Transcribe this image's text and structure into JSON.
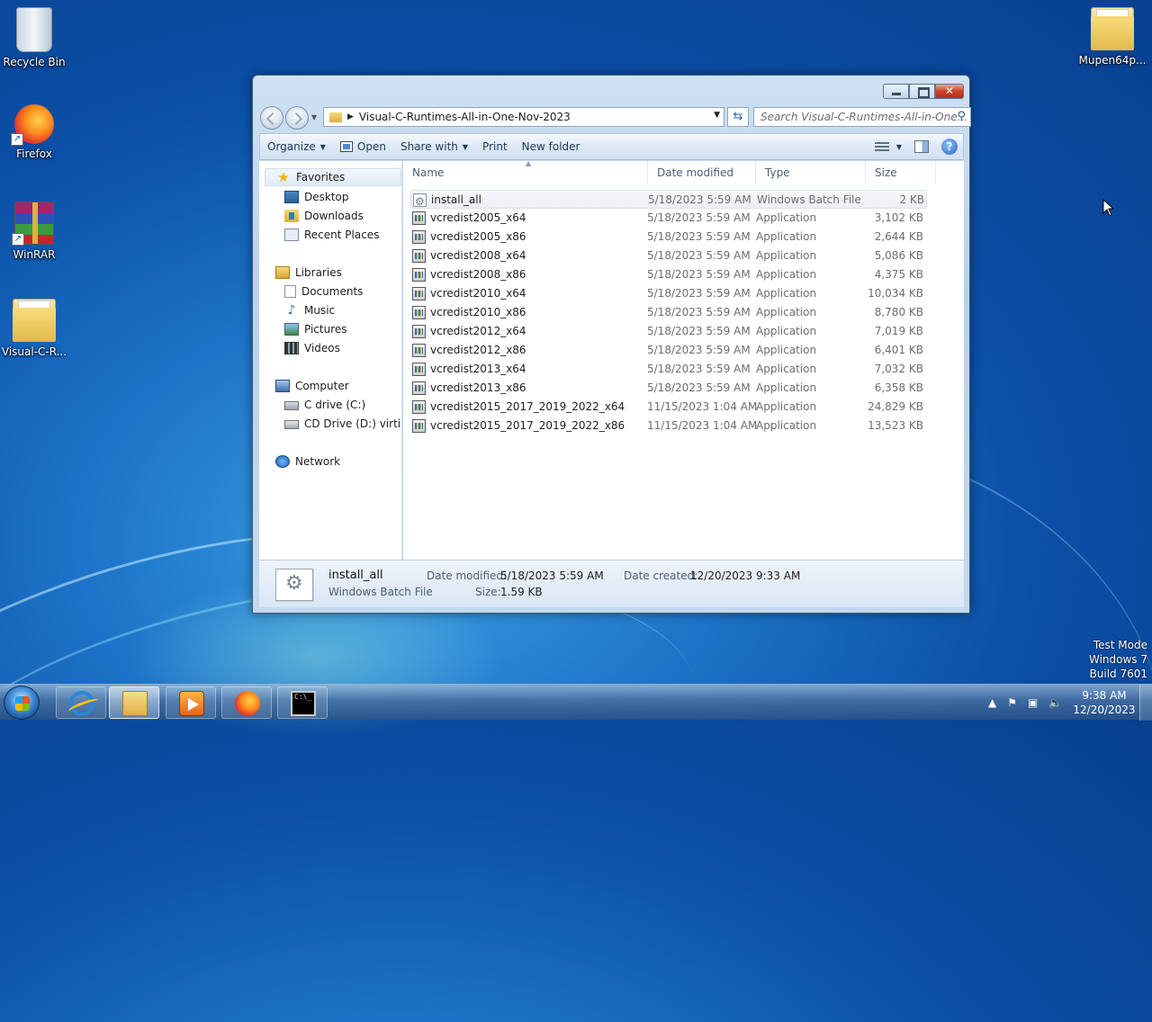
{
  "desktop": {
    "icons": [
      {
        "label": "Recycle Bin",
        "icon": "recycle-bin-icon"
      },
      {
        "label": "Firefox",
        "icon": "firefox-icon"
      },
      {
        "label": "WinRAR",
        "icon": "winrar-icon"
      },
      {
        "label": "Visual-C-R...",
        "icon": "folder-icon"
      },
      {
        "label": "Mupen64p...",
        "icon": "folder-icon"
      }
    ],
    "watermark": [
      "Test Mode",
      "Windows 7",
      "Build 7601"
    ]
  },
  "window": {
    "address": {
      "path": "Visual-C-Runtimes-All-in-One-Nov-2023"
    },
    "search": {
      "placeholder": "Search Visual-C-Runtimes-All-in-One..."
    },
    "toolbar": {
      "organize": "Organize",
      "open": "Open",
      "share_with": "Share with",
      "print": "Print",
      "new_folder": "New folder"
    },
    "nav": {
      "favorites": "Favorites",
      "desktop": "Desktop",
      "downloads": "Downloads",
      "recent_places": "Recent Places",
      "libraries": "Libraries",
      "documents": "Documents",
      "music": "Music",
      "pictures": "Pictures",
      "videos": "Videos",
      "computer": "Computer",
      "c_drive": "C drive (C:)",
      "cd_drive": "CD Drive (D:) virtio-win",
      "network": "Network"
    },
    "columns": {
      "name": "Name",
      "date_modified": "Date modified",
      "type": "Type",
      "size": "Size"
    },
    "files": [
      {
        "name": "install_all",
        "date": "5/18/2023 5:59 AM",
        "type": "Windows Batch File",
        "size": "2 KB",
        "kind": "bat"
      },
      {
        "name": "vcredist2005_x64",
        "date": "5/18/2023 5:59 AM",
        "type": "Application",
        "size": "3,102 KB",
        "kind": "app"
      },
      {
        "name": "vcredist2005_x86",
        "date": "5/18/2023 5:59 AM",
        "type": "Application",
        "size": "2,644 KB",
        "kind": "app"
      },
      {
        "name": "vcredist2008_x64",
        "date": "5/18/2023 5:59 AM",
        "type": "Application",
        "size": "5,086 KB",
        "kind": "app"
      },
      {
        "name": "vcredist2008_x86",
        "date": "5/18/2023 5:59 AM",
        "type": "Application",
        "size": "4,375 KB",
        "kind": "app"
      },
      {
        "name": "vcredist2010_x64",
        "date": "5/18/2023 5:59 AM",
        "type": "Application",
        "size": "10,034 KB",
        "kind": "app"
      },
      {
        "name": "vcredist2010_x86",
        "date": "5/18/2023 5:59 AM",
        "type": "Application",
        "size": "8,780 KB",
        "kind": "app"
      },
      {
        "name": "vcredist2012_x64",
        "date": "5/18/2023 5:59 AM",
        "type": "Application",
        "size": "7,019 KB",
        "kind": "app"
      },
      {
        "name": "vcredist2012_x86",
        "date": "5/18/2023 5:59 AM",
        "type": "Application",
        "size": "6,401 KB",
        "kind": "app"
      },
      {
        "name": "vcredist2013_x64",
        "date": "5/18/2023 5:59 AM",
        "type": "Application",
        "size": "7,032 KB",
        "kind": "app"
      },
      {
        "name": "vcredist2013_x86",
        "date": "5/18/2023 5:59 AM",
        "type": "Application",
        "size": "6,358 KB",
        "kind": "app"
      },
      {
        "name": "vcredist2015_2017_2019_2022_x64",
        "date": "11/15/2023 1:04 AM",
        "type": "Application",
        "size": "24,829 KB",
        "kind": "app"
      },
      {
        "name": "vcredist2015_2017_2019_2022_x86",
        "date": "11/15/2023 1:04 AM",
        "type": "Application",
        "size": "13,523 KB",
        "kind": "app"
      }
    ],
    "details": {
      "name": "install_all",
      "type": "Windows Batch File",
      "date_modified_label": "Date modified:",
      "date_modified": "5/18/2023 5:59 AM",
      "size_label": "Size:",
      "size": "1.59 KB",
      "date_created_label": "Date created:",
      "date_created": "12/20/2023 9:33 AM"
    }
  },
  "taskbar": {
    "clock": {
      "time": "9:38 AM",
      "date": "12/20/2023"
    }
  }
}
